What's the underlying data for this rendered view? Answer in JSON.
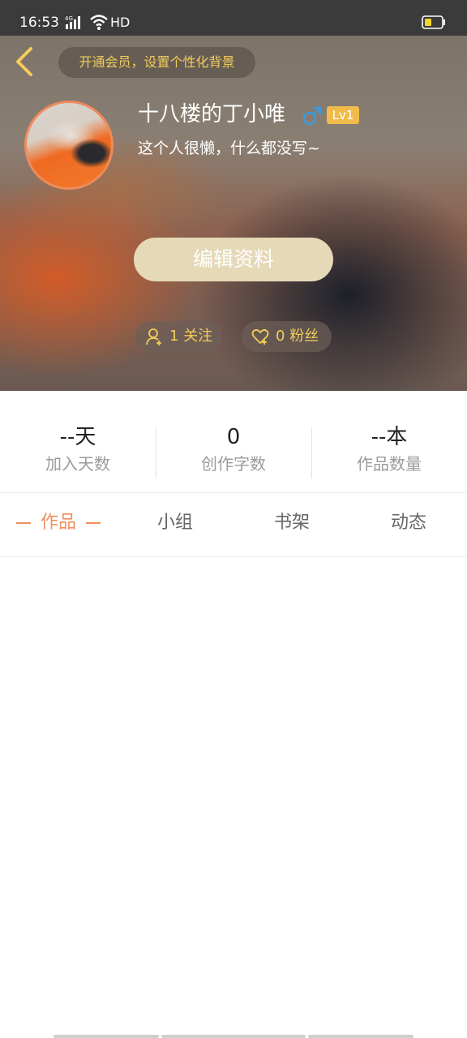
{
  "status_bar": {
    "time": "16:53",
    "network_label": "4G",
    "hd_label": "HD"
  },
  "header": {
    "vip_banner": "开通会员，设置个性化背景",
    "username": "十八楼的丁小唯",
    "gender_symbol": "♂",
    "level": "Lv1",
    "bio": "这个人很懒，什么都没写~",
    "edit_button": "编辑资料",
    "follow": {
      "count": "1",
      "label": "关注"
    },
    "fans": {
      "count": "0",
      "label": "粉丝"
    }
  },
  "stats": [
    {
      "value": "--天",
      "label": "加入天数"
    },
    {
      "value": "0",
      "label": "创作字数"
    },
    {
      "value": "--本",
      "label": "作品数量"
    }
  ],
  "tabs": [
    {
      "label": "作品",
      "active": true
    },
    {
      "label": "小组",
      "active": false
    },
    {
      "label": "书架",
      "active": false
    },
    {
      "label": "动态",
      "active": false
    }
  ],
  "colors": {
    "accent": "#ee8f5f",
    "vip_text": "#f3cd5a",
    "level_badge": "#f0bb4a",
    "gender": "#3a9be0",
    "edit_button": "#e6d9b7"
  }
}
